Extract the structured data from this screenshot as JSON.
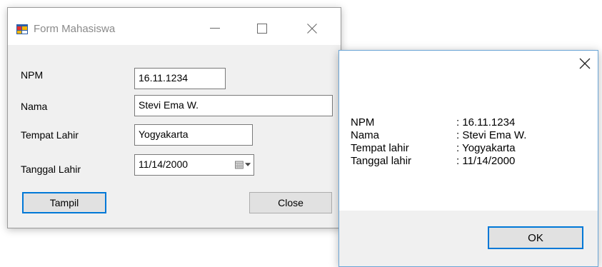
{
  "form": {
    "title": "Form Mahasiswa",
    "labels": {
      "npm": "NPM",
      "nama": "Nama",
      "tempat_lahir": "Tempat Lahir",
      "tanggal_lahir": "Tanggal Lahir"
    },
    "values": {
      "npm": "16.11.1234",
      "nama": "Stevi Ema W.",
      "tempat_lahir": "Yogyakarta",
      "tanggal_lahir": "11/14/2000"
    },
    "buttons": {
      "tampil": "Tampil",
      "close": "Close"
    }
  },
  "message": {
    "rows": [
      {
        "key": "NPM",
        "value": ": 16.11.1234"
      },
      {
        "key": "Nama",
        "value": ": Stevi Ema W."
      },
      {
        "key": "Tempat lahir",
        "value": ": Yogyakarta"
      },
      {
        "key": "Tanggal lahir",
        "value": ": 11/14/2000"
      }
    ],
    "ok_label": "OK"
  },
  "colors": {
    "accent": "#0078d7",
    "window_bg": "#f0f0f0",
    "button_bg": "#e1e1e1"
  }
}
